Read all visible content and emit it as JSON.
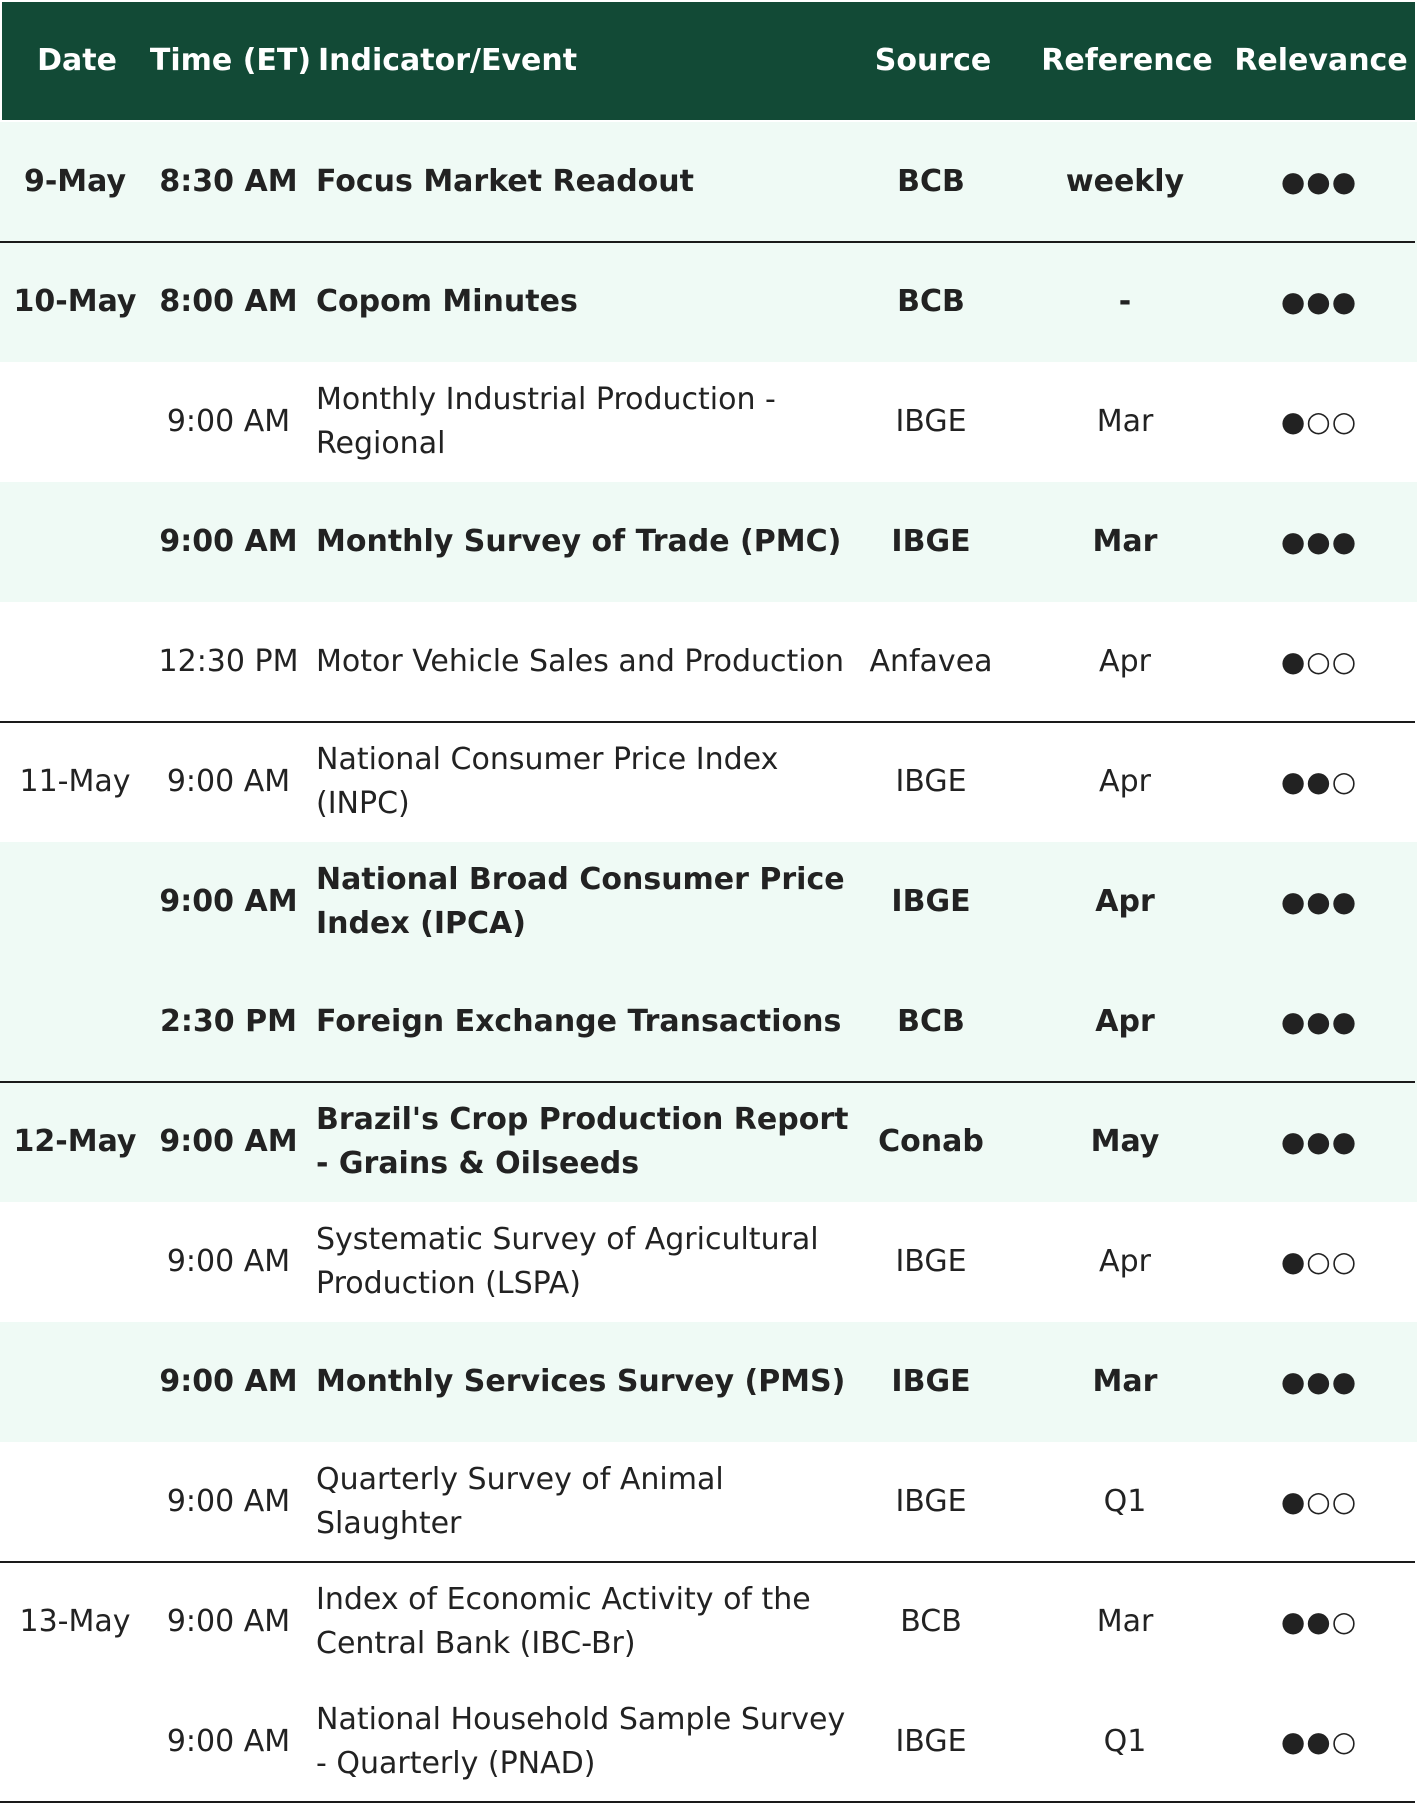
{
  "header": {
    "date": "Date",
    "time": "Time (ET)",
    "indicator": "Indicator/Event",
    "source": "Source",
    "reference": "Reference",
    "relevance": "Relevance"
  },
  "rows": [
    {
      "date": "9-May",
      "time": "8:30 AM",
      "indicator": "Focus Market Readout",
      "source": "BCB",
      "reference": "weekly",
      "relevance": "●●●",
      "relevance_level": 3,
      "bold": true,
      "shaded": true
    },
    {
      "date": "10-May",
      "time": "8:00 AM",
      "indicator": "Copom Minutes",
      "source": "BCB",
      "reference": "-",
      "relevance": "●●●",
      "relevance_level": 3,
      "bold": true,
      "shaded": true
    },
    {
      "date": "",
      "time": "9:00 AM",
      "indicator": "Monthly Industrial Production - Regional",
      "source": "IBGE",
      "reference": "Mar",
      "relevance": "●○○",
      "relevance_level": 1,
      "bold": false,
      "shaded": false
    },
    {
      "date": "",
      "time": "9:00 AM",
      "indicator": "Monthly Survey of Trade (PMC)",
      "source": "IBGE",
      "reference": "Mar",
      "relevance": "●●●",
      "relevance_level": 3,
      "bold": true,
      "shaded": true
    },
    {
      "date": "",
      "time": "12:30 PM",
      "indicator": "Motor Vehicle Sales and Production",
      "source": "Anfavea",
      "reference": "Apr",
      "relevance": "●○○",
      "relevance_level": 1,
      "bold": false,
      "shaded": false
    },
    {
      "date": "11-May",
      "time": "9:00 AM",
      "indicator": "National Consumer Price Index (INPC)",
      "source": "IBGE",
      "reference": "Apr",
      "relevance": "●●○",
      "relevance_level": 2,
      "bold": false,
      "shaded": false
    },
    {
      "date": "",
      "time": "9:00 AM",
      "indicator": "National Broad Consumer Price Index (IPCA)",
      "source": "IBGE",
      "reference": "Apr",
      "relevance": "●●●",
      "relevance_level": 3,
      "bold": true,
      "shaded": true
    },
    {
      "date": "",
      "time": "2:30 PM",
      "indicator": "Foreign Exchange Transactions",
      "source": "BCB",
      "reference": "Apr",
      "relevance": "●●●",
      "relevance_level": 3,
      "bold": true,
      "shaded": true
    },
    {
      "date": "12-May",
      "time": "9:00 AM",
      "indicator": "Brazil's Crop Production Report - Grains & Oilseeds",
      "source": "Conab",
      "reference": "May",
      "relevance": "●●●",
      "relevance_level": 3,
      "bold": true,
      "shaded": true
    },
    {
      "date": "",
      "time": "9:00 AM",
      "indicator": "Systematic Survey of Agricultural Production (LSPA)",
      "source": "IBGE",
      "reference": "Apr",
      "relevance": "●○○",
      "relevance_level": 1,
      "bold": false,
      "shaded": false
    },
    {
      "date": "",
      "time": "9:00 AM",
      "indicator": "Monthly Services Survey (PMS)",
      "source": "IBGE",
      "reference": "Mar",
      "relevance": "●●●",
      "relevance_level": 3,
      "bold": true,
      "shaded": true
    },
    {
      "date": "",
      "time": "9:00 AM",
      "indicator": "Quarterly Survey of Animal Slaughter",
      "source": "IBGE",
      "reference": "Q1",
      "relevance": "●○○",
      "relevance_level": 1,
      "bold": false,
      "shaded": false
    },
    {
      "date": "13-May",
      "time": "9:00 AM",
      "indicator": "Index of Economic Activity of the Central Bank (IBC-Br)",
      "source": "BCB",
      "reference": "Mar",
      "relevance": "●●○",
      "relevance_level": 2,
      "bold": false,
      "shaded": false
    },
    {
      "date": "",
      "time": "9:00 AM",
      "indicator": "National Household Sample Survey - Quarterly (PNAD)",
      "source": "IBGE",
      "reference": "Q1",
      "relevance": "●●○",
      "relevance_level": 2,
      "bold": false,
      "shaded": false
    }
  ],
  "colors": {
    "header_bg": "#124a36",
    "header_text": "#ffffff",
    "shaded_row": "#effaf5",
    "separator": "#1a1a1a"
  }
}
